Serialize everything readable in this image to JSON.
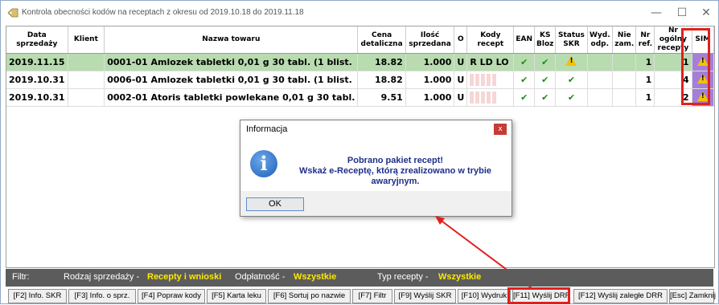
{
  "window": {
    "title": "Kontrola obecności kodów na receptach z okresu od 2019.10.18 do 2019.11.18",
    "minimize": "—",
    "maximize": "☐",
    "close": "✕"
  },
  "table": {
    "headers": {
      "data": "Data sprzedaży",
      "klient": "Klient",
      "nazwa": "Nazwa towaru",
      "cena": "Cena detaliczna",
      "ilosc": "Ilość sprzedana",
      "o": "O",
      "kody": "Kody recept",
      "ean": "EAN",
      "ks": "KS Bloz",
      "status": "Status SKR",
      "wyd": "Wyd. odp.",
      "nie": "Nie zam.",
      "nr": "Nr ref.",
      "nrog": "Nr ogólny recepty",
      "sim": "SIM"
    },
    "rows": [
      {
        "data": "2019.11.15",
        "klient": "",
        "nazwa": "0001-01 Amlozek tabletki 0,01 g 30 tabl. (1 blist.",
        "cena": "18.82",
        "ilosc": "1.000",
        "o": "U",
        "kody": "R  LD  LO",
        "ean": "✔",
        "ks": "✔",
        "status": "warning",
        "nr": "1",
        "nrog": "1",
        "sim": "warning"
      },
      {
        "data": "2019.10.31",
        "klient": "",
        "nazwa": "0006-01 Amlozek tabletki 0,01 g 30 tabl. (1 blist.",
        "cena": "18.82",
        "ilosc": "1.000",
        "o": "U",
        "kody": "",
        "ean": "✔",
        "ks": "✔",
        "status": "✔",
        "nr": "1",
        "nrog": "4",
        "sim": "warning"
      },
      {
        "data": "2019.10.31",
        "klient": "",
        "nazwa": "0002-01 Atoris tabletki powlekane 0,01 g 30 tabl.",
        "cena": "9.51",
        "ilosc": "1.000",
        "o": "U",
        "kody": "",
        "ean": "✔",
        "ks": "✔",
        "status": "✔",
        "nr": "1",
        "nrog": "2",
        "sim": "warning"
      }
    ]
  },
  "dialog": {
    "title": "Informacja",
    "close": "x",
    "line1": "Pobrano pakiet recept!",
    "line2": "Wskaż e-Receptę, którą zrealizowano w trybie awaryjnym.",
    "ok": "OK",
    "icon": "info-icon"
  },
  "filter": {
    "label": "Filtr:",
    "rodzaj_label": "Rodzaj sprzedaży -",
    "rodzaj_value": "Recepty i wnioski",
    "odplatnosc_label": "Odpłatność -",
    "odplatnosc_value": "Wszystkie",
    "typ_label": "Typ recepty -",
    "typ_value": "Wszystkie"
  },
  "buttons": {
    "f2": "[F2] Info. SKR",
    "f3": "[F3] Info. o sprz.",
    "f4": "[F4] Popraw kody",
    "f5": "[F5] Karta leku",
    "f6": "[F6] Sortuj po nazwie",
    "f7": "[F7] Filtr",
    "f9": "[F9] Wyślij SKR",
    "f10": "[F10] Wydruk",
    "f11": "[F11] Wyślij DRR",
    "f12": "[F12] Wyślij zaległe DRR",
    "esc": "[Esc] Zamknij"
  },
  "colors": {
    "selected_row": "#b8dcb0",
    "sim_cell": "#a47fd8",
    "highlight": "#e0201d",
    "filter_value": "#ffe800"
  }
}
